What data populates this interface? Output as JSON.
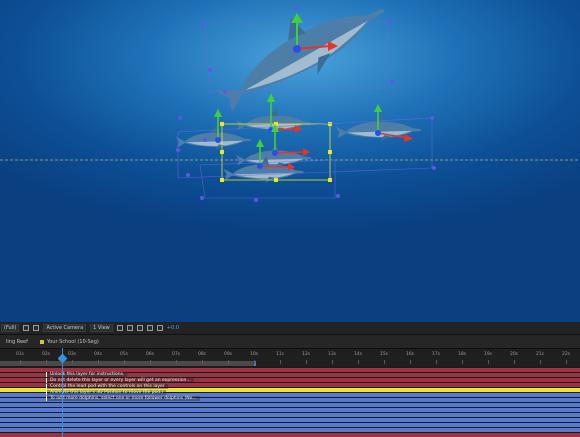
{
  "viewer": {
    "magnification": "(Full)",
    "camera": "Active Camera",
    "views": "1 View",
    "exposure": "+0.0"
  },
  "tabs": [
    {
      "label": "ling Reef"
    },
    {
      "label": "Your School (10-Seg)"
    }
  ],
  "ruler": {
    "labels": [
      "01s",
      "02s",
      "03s",
      "04s",
      "05s",
      "06s",
      "07s",
      "08s",
      "09s",
      "10s",
      "11s",
      "12s",
      "13s",
      "14s",
      "15s",
      "16s",
      "17s",
      "18s",
      "19s",
      "20s",
      "21s",
      "22s"
    ]
  },
  "markers": [
    "Unlock this layer for instructions.",
    "Do not delete this layer or every layer will get an expression...",
    "Control the lead pod with the controls on this layer",
    "Animate this layer's 3D Position to move the pod.)",
    "To add more dolphins, select one or more follower dolphins (No..."
  ],
  "colors": {
    "track_red": "#b0374b",
    "track_yellow": "#e9e33a",
    "track_blue": "#5a7fd9",
    "gizmo_x": "#e8332a",
    "gizmo_y": "#3ed13a",
    "gizmo_z": "#2a4fe8",
    "selection": "#e8e82a"
  }
}
